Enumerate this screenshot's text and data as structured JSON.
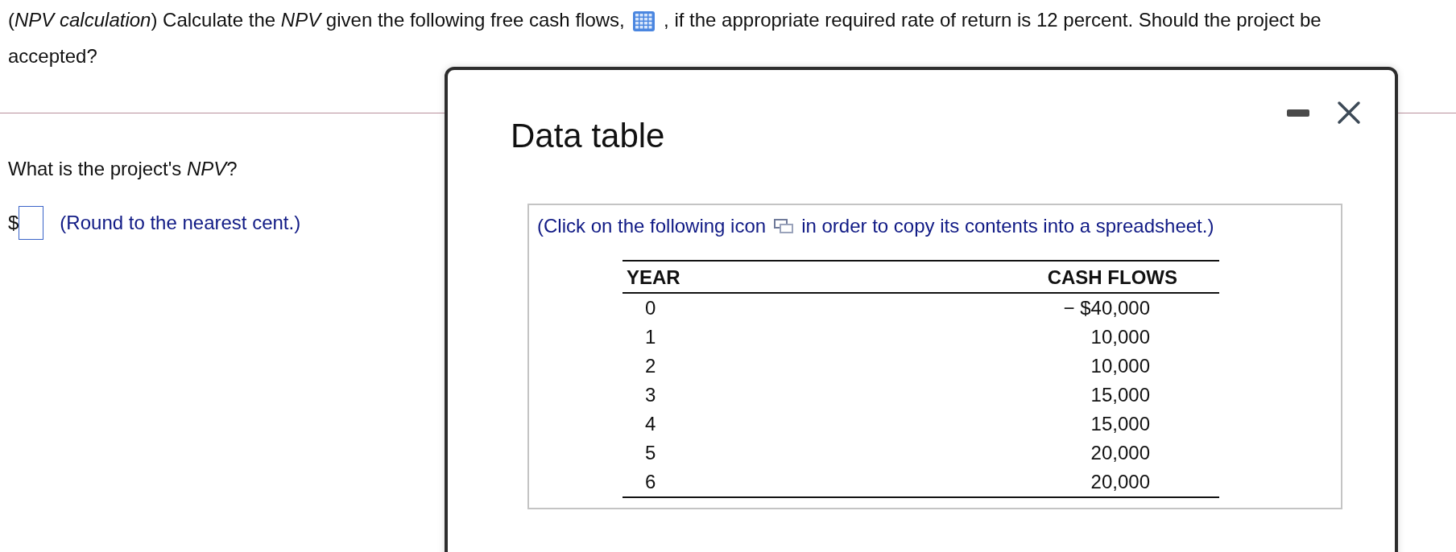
{
  "question": {
    "before_icon": "(*NPV calculation*) Calculate the *NPV* given the following free cash flows,",
    "after_icon": ", if the appropriate required rate of return is 12 percent. Should the project be",
    "continuation": "accepted?"
  },
  "prompt": "What is the project's *NPV*?",
  "answer": {
    "prefix": "$",
    "hint": "(Round to the nearest cent.)"
  },
  "dialog": {
    "title": "Data table",
    "instruction_before": "(Click on the following icon",
    "instruction_after": "in order to copy its contents into a spreadsheet.)",
    "columns": [
      "YEAR",
      "CASH FLOWS"
    ],
    "rows": [
      {
        "year": "0",
        "cash_flow": "− $40,000"
      },
      {
        "year": "1",
        "cash_flow": "10,000"
      },
      {
        "year": "2",
        "cash_flow": "10,000"
      },
      {
        "year": "3",
        "cash_flow": "15,000"
      },
      {
        "year": "4",
        "cash_flow": "15,000"
      },
      {
        "year": "5",
        "cash_flow": "20,000"
      },
      {
        "year": "6",
        "cash_flow": "20,000"
      }
    ]
  }
}
